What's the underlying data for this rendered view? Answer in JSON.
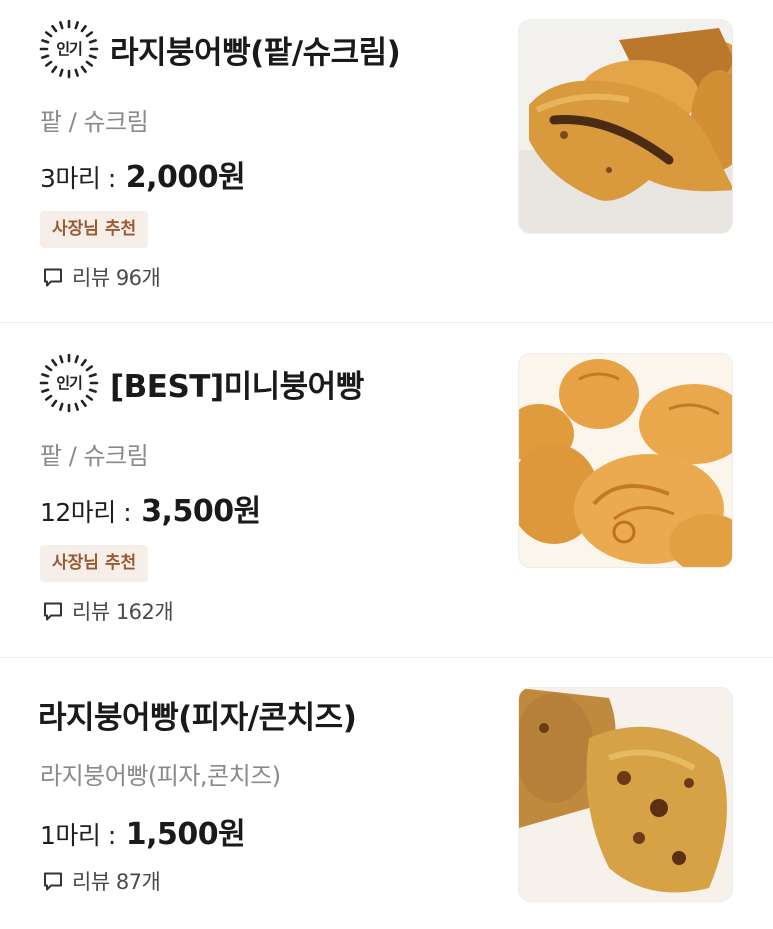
{
  "menu": {
    "items": [
      {
        "popular_label": "인기",
        "name": "라지붕어빵(팥/슈크림)",
        "description": "팥 / 슈크림",
        "quantity": "3마리 :",
        "price": "2,000원",
        "owner_badge": "사장님 추천",
        "review": "리뷰 96개",
        "image_icon": "bungeoppang-photo"
      },
      {
        "popular_label": "인기",
        "name": "[BEST]미니붕어빵",
        "description": "팥 / 슈크림",
        "quantity": "12마리 :",
        "price": "3,500원",
        "owner_badge": "사장님 추천",
        "review": "리뷰 162개",
        "image_icon": "mini-bungeoppang-photo"
      },
      {
        "name": "라지붕어빵(피자/콘치즈)",
        "description": "라지붕어빵(피자,콘치즈)",
        "quantity": "1마리 :",
        "price": "1,500원",
        "review": "리뷰 87개",
        "image_icon": "pizza-bungeoppang-photo"
      }
    ]
  },
  "colors": {
    "owner_badge_bg": "#f6eee8",
    "owner_badge_text": "#9a5a34",
    "description_text": "#8a8a8a",
    "divider": "#ececec"
  }
}
